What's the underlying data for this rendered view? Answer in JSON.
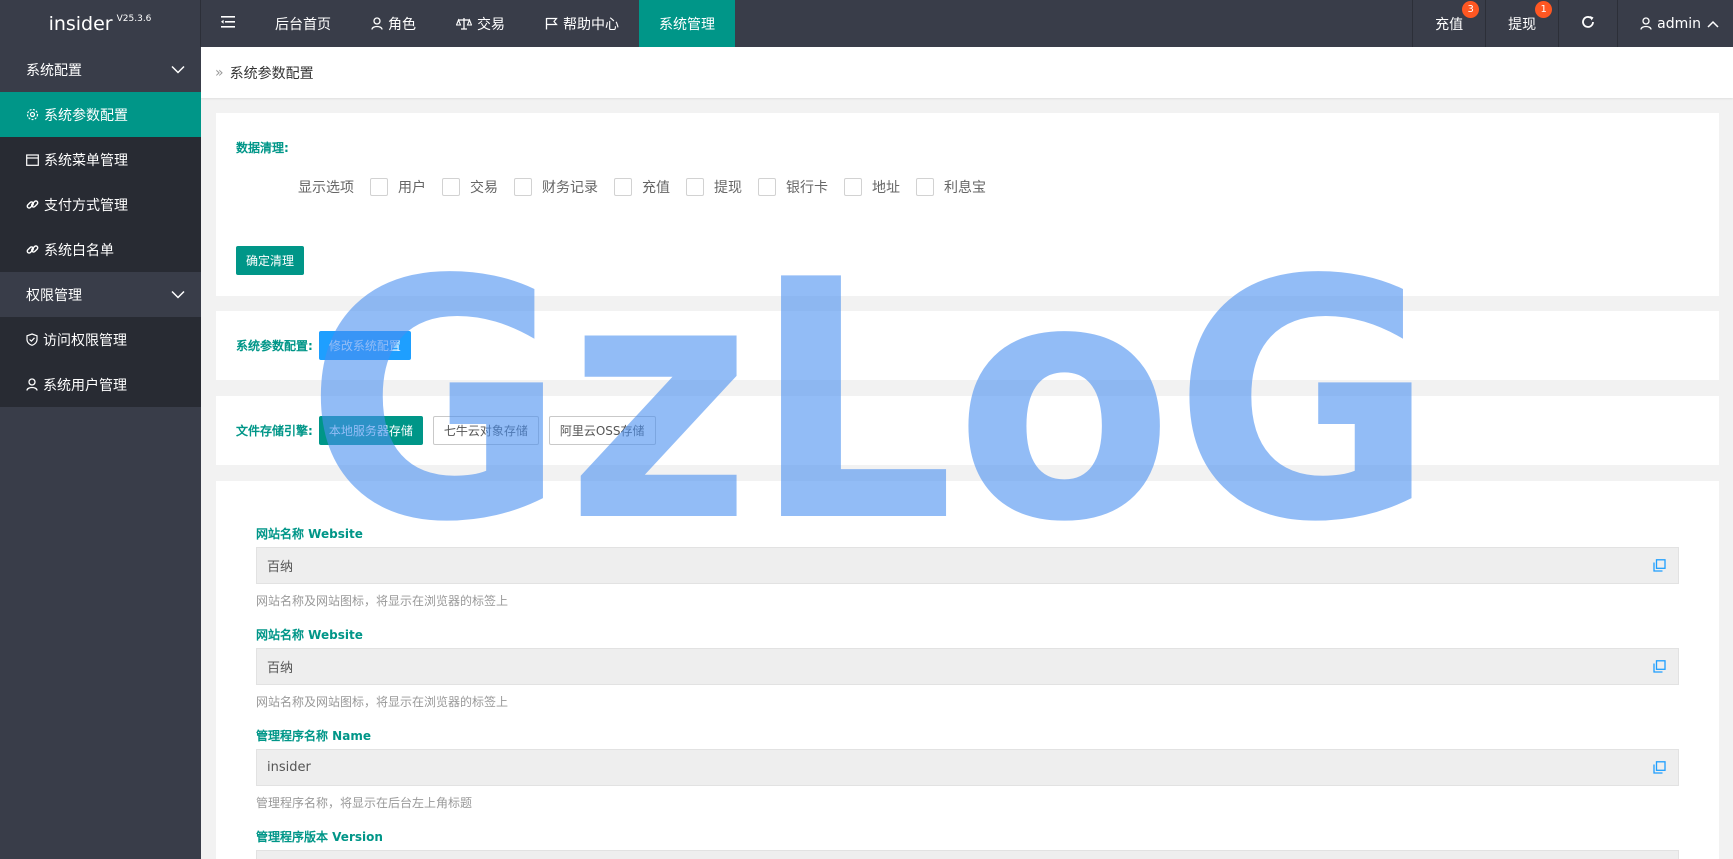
{
  "app": {
    "name": "insider",
    "version": "V25.3.6"
  },
  "topnav": {
    "items": [
      {
        "label": "后台首页",
        "icon": "none"
      },
      {
        "label": "角色",
        "icon": "user-icon"
      },
      {
        "label": "交易",
        "icon": "scale-icon"
      },
      {
        "label": "帮助中心",
        "icon": "flag-icon"
      },
      {
        "label": "系统管理",
        "icon": "none",
        "active": true
      }
    ],
    "right": {
      "recharge": {
        "label": "充值",
        "badge": "3"
      },
      "withdraw": {
        "label": "提现",
        "badge": "1"
      },
      "user": "admin"
    }
  },
  "sidebar": {
    "groups": [
      {
        "label": "系统配置",
        "items": [
          "系统参数配置",
          "系统菜单管理",
          "支付方式管理",
          "系统白名单"
        ]
      },
      {
        "label": "权限管理",
        "items": [
          "访问权限管理",
          "系统用户管理"
        ]
      }
    ]
  },
  "breadcrumb": "系统参数配置",
  "cleanup": {
    "title": "数据清理:",
    "options_label": "显示选项",
    "options": [
      "用户",
      "交易",
      "财务记录",
      "充值",
      "提现",
      "银行卡",
      "地址",
      "利息宝"
    ],
    "confirm": "确定清理"
  },
  "sysparams": {
    "label": "系统参数配置:",
    "button": "修改系统配置"
  },
  "storage": {
    "label": "文件存储引擎:",
    "local": "本地服务器存储",
    "qiniu": "七牛云对象存储",
    "aliyun": "阿里云OSS存储"
  },
  "fields": [
    {
      "label": "网站名称 Website",
      "value": "百纳",
      "hint": "网站名称及网站图标，将显示在浏览器的标签上"
    },
    {
      "label": "网站名称 Website",
      "value": "百纳",
      "hint": "网站名称及网站图标，将显示在浏览器的标签上"
    },
    {
      "label": "管理程序名称 Name",
      "value": "insider",
      "hint": "管理程序名称，将显示在后台左上角标题"
    },
    {
      "label": "管理程序版本 Version",
      "value": "",
      "hint": ""
    }
  ],
  "watermark": "GzLoG",
  "colors": {
    "topbar": "#393d49",
    "accent": "#009688",
    "blue": "#1e9fff",
    "badge": "#ff5722",
    "watermark": "#4a90f0"
  }
}
